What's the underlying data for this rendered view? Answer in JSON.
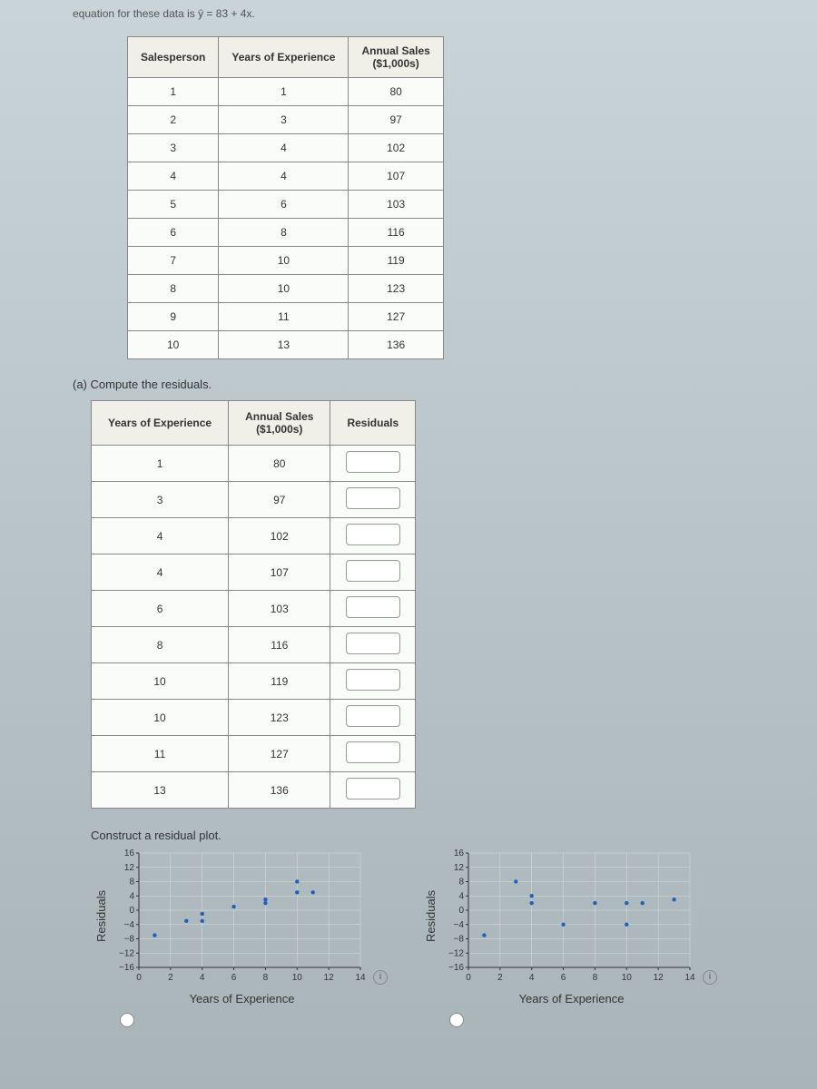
{
  "header_text": "equation for these data is ŷ = 83 + 4x.",
  "table1": {
    "headers": [
      "Salesperson",
      "Years of Experience",
      "Annual Sales ($1,000s)"
    ],
    "rows": [
      [
        "1",
        "1",
        "80"
      ],
      [
        "2",
        "3",
        "97"
      ],
      [
        "3",
        "4",
        "102"
      ],
      [
        "4",
        "4",
        "107"
      ],
      [
        "5",
        "6",
        "103"
      ],
      [
        "6",
        "8",
        "116"
      ],
      [
        "7",
        "10",
        "119"
      ],
      [
        "8",
        "10",
        "123"
      ],
      [
        "9",
        "11",
        "127"
      ],
      [
        "10",
        "13",
        "136"
      ]
    ]
  },
  "question_a": "(a)  Compute the residuals.",
  "table2": {
    "headers": [
      "Years of Experience",
      "Annual Sales ($1,000s)",
      "Residuals"
    ],
    "rows": [
      [
        "1",
        "80"
      ],
      [
        "3",
        "97"
      ],
      [
        "4",
        "102"
      ],
      [
        "4",
        "107"
      ],
      [
        "6",
        "103"
      ],
      [
        "8",
        "116"
      ],
      [
        "10",
        "119"
      ],
      [
        "10",
        "123"
      ],
      [
        "11",
        "127"
      ],
      [
        "13",
        "136"
      ]
    ]
  },
  "construct_label": "Construct a residual plot.",
  "chart_data": [
    {
      "type": "scatter",
      "xlabel": "Years of Experience",
      "ylabel": "Residuals",
      "xrange": [
        0,
        14
      ],
      "yrange": [
        -16,
        16
      ],
      "xticks": [
        0,
        2,
        4,
        6,
        8,
        10,
        12,
        14
      ],
      "yticks": [
        -16,
        -12,
        -8,
        -4,
        0,
        4,
        8,
        12,
        16
      ],
      "points": [
        {
          "x": 1,
          "y": -7
        },
        {
          "x": 3,
          "y": -3
        },
        {
          "x": 4,
          "y": -3
        },
        {
          "x": 4,
          "y": -1
        },
        {
          "x": 6,
          "y": 1
        },
        {
          "x": 8,
          "y": 2
        },
        {
          "x": 8,
          "y": 3
        },
        {
          "x": 10,
          "y": 5
        },
        {
          "x": 10,
          "y": 8
        },
        {
          "x": 11,
          "y": 5
        }
      ]
    },
    {
      "type": "scatter",
      "xlabel": "Years of Experience",
      "ylabel": "Residuals",
      "xrange": [
        0,
        14
      ],
      "yrange": [
        -16,
        16
      ],
      "xticks": [
        0,
        2,
        4,
        6,
        8,
        10,
        12,
        14
      ],
      "yticks": [
        -16,
        -12,
        -8,
        -4,
        0,
        4,
        8,
        12,
        16
      ],
      "points": [
        {
          "x": 1,
          "y": -7
        },
        {
          "x": 3,
          "y": 8
        },
        {
          "x": 4,
          "y": 4
        },
        {
          "x": 4,
          "y": 2
        },
        {
          "x": 6,
          "y": -4
        },
        {
          "x": 8,
          "y": 2
        },
        {
          "x": 10,
          "y": -4
        },
        {
          "x": 10,
          "y": 2
        },
        {
          "x": 11,
          "y": 2
        },
        {
          "x": 13,
          "y": 3
        }
      ]
    }
  ]
}
